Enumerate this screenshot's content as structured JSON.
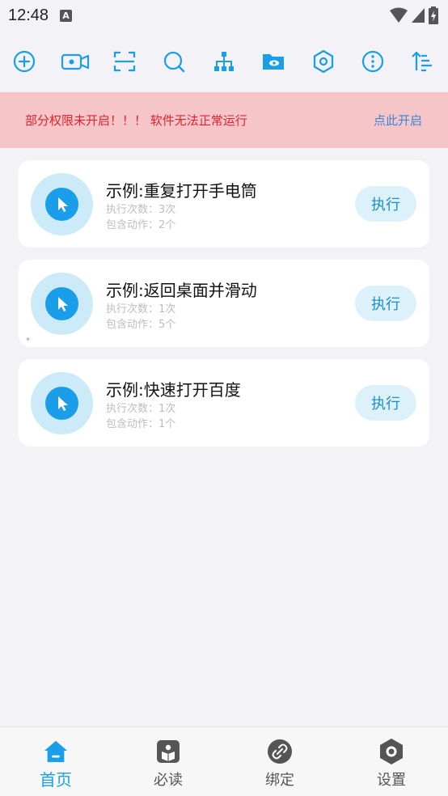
{
  "status_bar": {
    "time": "12:48",
    "indicator": "A"
  },
  "toolbar": {
    "icons": [
      "add-circle-icon",
      "video-icon",
      "scan-icon",
      "search-icon",
      "hierarchy-icon",
      "folder-eye-icon",
      "hexagon-settings-icon",
      "more-icon",
      "sort-icon"
    ]
  },
  "warning": {
    "text": "部分权限未开启！！！ 软件无法正常运行",
    "link": "点此开启"
  },
  "tasks": [
    {
      "title": "示例:重复打开手电筒",
      "exec_count": "执行次数：3次",
      "action_count": "包含动作：2个",
      "button": "执行"
    },
    {
      "title": "示例:返回桌面并滑动",
      "exec_count": "执行次数：1次",
      "action_count": "包含动作：5个",
      "button": "执行"
    },
    {
      "title": "示例:快速打开百度",
      "exec_count": "执行次数：1次",
      "action_count": "包含动作：1个",
      "button": "执行"
    }
  ],
  "nav": [
    {
      "label": "首页",
      "icon": "home-icon",
      "active": true
    },
    {
      "label": "必读",
      "icon": "read-icon",
      "active": false
    },
    {
      "label": "绑定",
      "icon": "link-icon",
      "active": false
    },
    {
      "label": "设置",
      "icon": "settings-icon",
      "active": false
    }
  ],
  "colors": {
    "accent": "#1a9ee9",
    "warning_bg": "#f5c5c8",
    "warning_text": "#e0242e",
    "link": "#3a86d6"
  }
}
